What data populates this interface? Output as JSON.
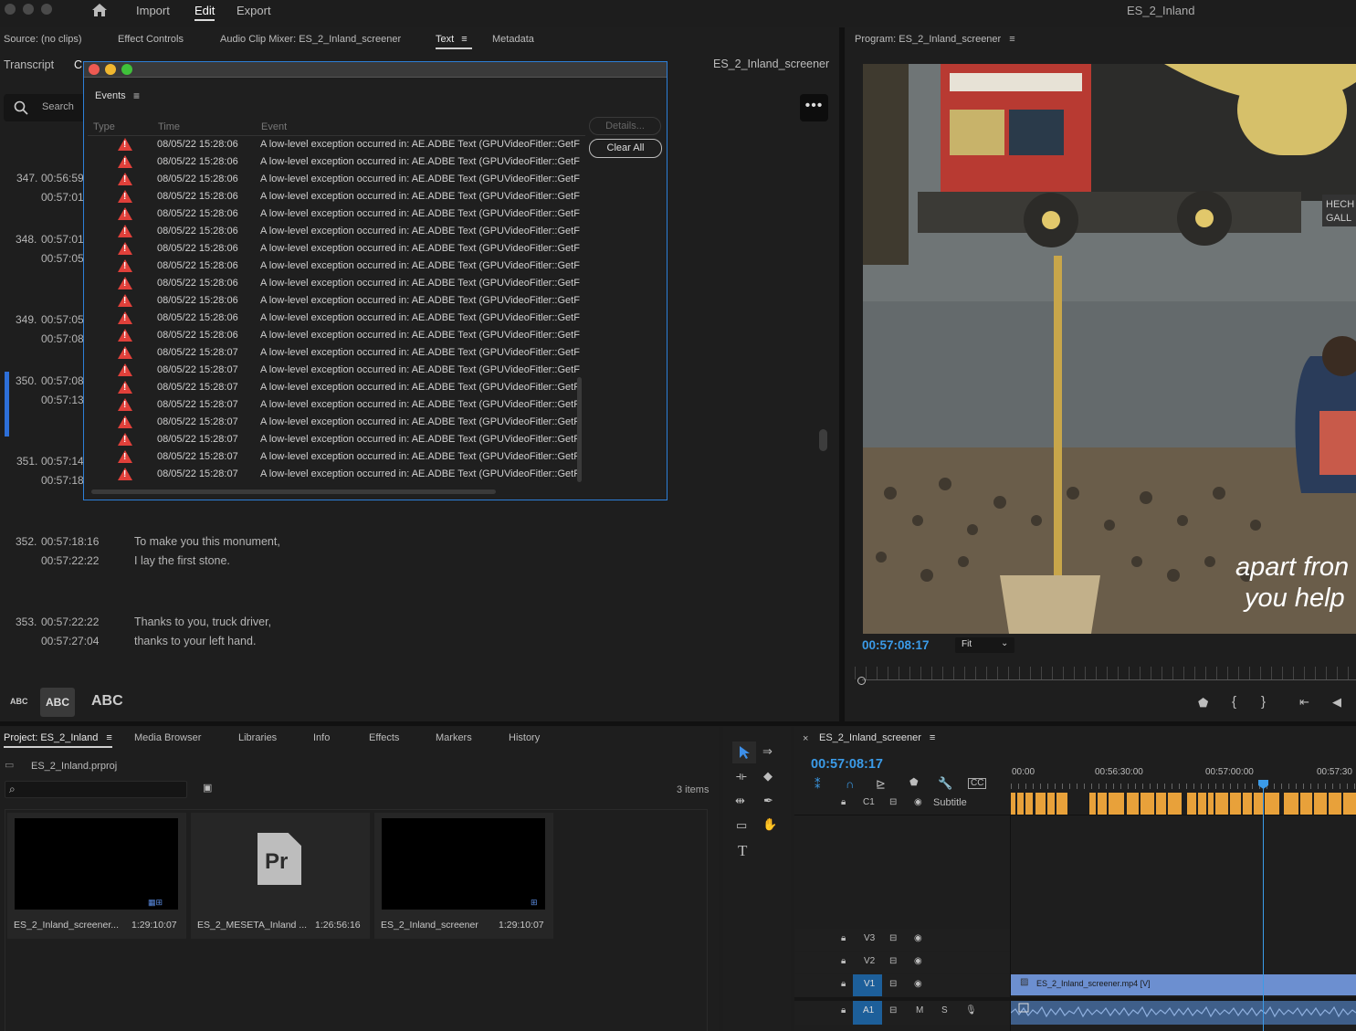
{
  "app": {
    "workspaces": [
      "Import",
      "Edit",
      "Export"
    ],
    "active_workspace": "Edit",
    "project_title": "ES_2_Inland"
  },
  "top_tabs": {
    "source": "Source: (no clips)",
    "effect_controls": "Effect Controls",
    "audio_clip_mixer": "Audio Clip Mixer: ES_2_Inland_screener",
    "text": "Text",
    "metadata": "Metadata",
    "program": "Program: ES_2_Inland_screener"
  },
  "text_panel": {
    "subtabs": [
      "Transcript",
      "C"
    ],
    "sequence_name": "ES_2_Inland_screener",
    "search_placeholder": "Search",
    "captions": [
      {
        "num": "347.",
        "in": "00:56:59",
        "out": "00:57:01:",
        "line1": "",
        "line2": ""
      },
      {
        "num": "348.",
        "in": "00:57:01:",
        "out": "00:57:05",
        "line1": "",
        "line2": ""
      },
      {
        "num": "349.",
        "in": "00:57:05",
        "out": "00:57:08",
        "line1": "",
        "line2": ""
      },
      {
        "num": "350.",
        "in": "00:57:08",
        "out": "00:57:13:",
        "line1": "",
        "line2": ""
      },
      {
        "num": "351.",
        "in": "00:57:14:",
        "out": "00:57:18:",
        "line1": "",
        "line2": ""
      },
      {
        "num": "352.",
        "in": "00:57:18:16",
        "out": "00:57:22:22",
        "line1": "To make you this monument,",
        "line2": "I lay the first stone."
      },
      {
        "num": "353.",
        "in": "00:57:22:22",
        "out": "00:57:27:04",
        "line1": "Thanks to you, truck driver,",
        "line2": "thanks to your left hand."
      }
    ],
    "text_sizes": [
      "ABC",
      "ABC",
      "ABC"
    ]
  },
  "events_dialog": {
    "title": "Events",
    "columns": [
      "Type",
      "Time",
      "Event"
    ],
    "details_label": "Details...",
    "clear_all_label": "Clear All",
    "rows": [
      {
        "time": "08/05/22 15:28:06",
        "msg": "A low-level exception occurred in: AE.ADBE Text (GPUVideoFitler::GetF"
      },
      {
        "time": "08/05/22 15:28:06",
        "msg": "A low-level exception occurred in: AE.ADBE Text (GPUVideoFitler::GetF"
      },
      {
        "time": "08/05/22 15:28:06",
        "msg": "A low-level exception occurred in: AE.ADBE Text (GPUVideoFitler::GetF"
      },
      {
        "time": "08/05/22 15:28:06",
        "msg": "A low-level exception occurred in: AE.ADBE Text (GPUVideoFitler::GetF"
      },
      {
        "time": "08/05/22 15:28:06",
        "msg": "A low-level exception occurred in: AE.ADBE Text (GPUVideoFitler::GetF"
      },
      {
        "time": "08/05/22 15:28:06",
        "msg": "A low-level exception occurred in: AE.ADBE Text (GPUVideoFitler::GetF"
      },
      {
        "time": "08/05/22 15:28:06",
        "msg": "A low-level exception occurred in: AE.ADBE Text (GPUVideoFitler::GetF"
      },
      {
        "time": "08/05/22 15:28:06",
        "msg": "A low-level exception occurred in: AE.ADBE Text (GPUVideoFitler::GetF"
      },
      {
        "time": "08/05/22 15:28:06",
        "msg": "A low-level exception occurred in: AE.ADBE Text (GPUVideoFitler::GetF"
      },
      {
        "time": "08/05/22 15:28:06",
        "msg": "A low-level exception occurred in: AE.ADBE Text (GPUVideoFitler::GetF"
      },
      {
        "time": "08/05/22 15:28:06",
        "msg": "A low-level exception occurred in: AE.ADBE Text (GPUVideoFitler::GetF"
      },
      {
        "time": "08/05/22 15:28:06",
        "msg": "A low-level exception occurred in: AE.ADBE Text (GPUVideoFitler::GetF"
      },
      {
        "time": "08/05/22 15:28:07",
        "msg": "A low-level exception occurred in: AE.ADBE Text (GPUVideoFitler::GetF"
      },
      {
        "time": "08/05/22 15:28:07",
        "msg": "A low-level exception occurred in: AE.ADBE Text (GPUVideoFitler::GetF"
      },
      {
        "time": "08/05/22 15:28:07",
        "msg": "A low-level exception occurred in: AE.ADBE Text (GPUVideoFitler::GetF"
      },
      {
        "time": "08/05/22 15:28:07",
        "msg": "A low-level exception occurred in: AE.ADBE Text (GPUVideoFitler::GetF"
      },
      {
        "time": "08/05/22 15:28:07",
        "msg": "A low-level exception occurred in: AE.ADBE Text (GPUVideoFitler::GetF"
      },
      {
        "time": "08/05/22 15:28:07",
        "msg": "A low-level exception occurred in: AE.ADBE Text (GPUVideoFitler::GetF"
      },
      {
        "time": "08/05/22 15:28:07",
        "msg": "A low-level exception occurred in: AE.ADBE Text (GPUVideoFitler::GetF"
      },
      {
        "time": "08/05/22 15:28:07",
        "msg": "A low-level exception occurred in: AE.ADBE Text (GPUVideoFitler::GetF"
      }
    ]
  },
  "program_monitor": {
    "timecode": "00:57:08:17",
    "fit": "Fit",
    "subtitle_line1": "apart fron",
    "subtitle_line2": "you help",
    "sign_text1": "HECH",
    "sign_text2": "GALL"
  },
  "project_panel": {
    "tabs": [
      "Project: ES_2_Inland",
      "Media Browser",
      "Libraries",
      "Info",
      "Effects",
      "Markers",
      "History"
    ],
    "project_file": "ES_2_Inland.prproj",
    "items_count": "3 items",
    "items": [
      {
        "name": "ES_2_Inland_screener...",
        "duration": "1:29:10:07"
      },
      {
        "name": "ES_2_MESETA_Inland ...",
        "duration": "1:26:56:16",
        "badge": "Pr"
      },
      {
        "name": "ES_2_Inland_screener",
        "duration": "1:29:10:07"
      }
    ]
  },
  "timeline": {
    "sequence": "ES_2_Inland_screener",
    "timecode": "00:57:08:17",
    "ruler": [
      "00:00",
      "00:56:30:00",
      "00:57:00:00",
      "00:57:30"
    ],
    "caption_track": {
      "label": "C1",
      "name": "Subtitle"
    },
    "tracks": [
      "V3",
      "V2",
      "V1",
      "A1"
    ],
    "v1_clip": "ES_2_Inland_screener.mp4 [V]",
    "mute": "M",
    "solo": "S"
  },
  "colors": {
    "accent_blue": "#2d8ceb",
    "caption_orange": "#e8a13a",
    "clip_blue": "#6c8fd0",
    "warning_red": "#e0403a"
  }
}
